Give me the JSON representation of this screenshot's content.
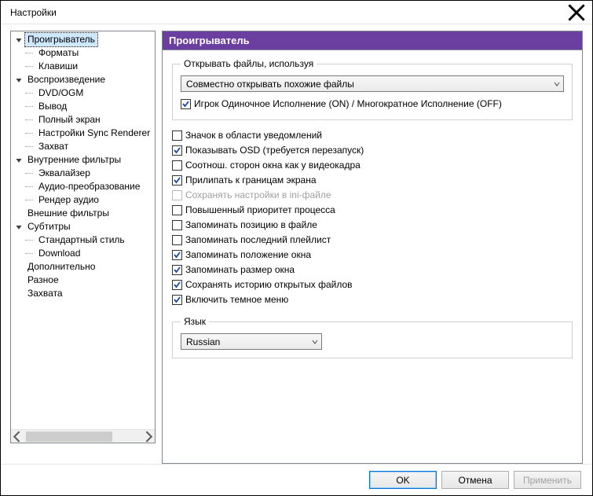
{
  "window": {
    "title": "Настройки"
  },
  "tree": {
    "items": [
      {
        "label": "Проигрыватель",
        "type": "root",
        "expanded": true,
        "selected": true
      },
      {
        "label": "Форматы",
        "type": "child"
      },
      {
        "label": "Клавиши",
        "type": "child"
      },
      {
        "label": "Воспроизведение",
        "type": "root",
        "expanded": true
      },
      {
        "label": "DVD/OGM",
        "type": "child"
      },
      {
        "label": "Вывод",
        "type": "child"
      },
      {
        "label": "Полный экран",
        "type": "child"
      },
      {
        "label": "Настройки Sync Renderer",
        "type": "child"
      },
      {
        "label": "Захват",
        "type": "child"
      },
      {
        "label": "Внутренние фильтры",
        "type": "root",
        "expanded": true
      },
      {
        "label": "Эквалайзер",
        "type": "child"
      },
      {
        "label": "Аудио-преобразование",
        "type": "child"
      },
      {
        "label": "Рендер аудио",
        "type": "child"
      },
      {
        "label": "Внешние фильтры",
        "type": "root",
        "noarrow": true
      },
      {
        "label": "Субтитры",
        "type": "root",
        "expanded": true
      },
      {
        "label": "Стандартный стиль",
        "type": "child"
      },
      {
        "label": "Download",
        "type": "child"
      },
      {
        "label": "Дополнительно",
        "type": "root",
        "noarrow": true
      },
      {
        "label": "Разное",
        "type": "root",
        "noarrow": true
      },
      {
        "label": "Захвата",
        "type": "root",
        "noarrow": true
      }
    ]
  },
  "page": {
    "heading": "Проигрыватель",
    "open_group": {
      "legend": "Открывать файлы, используя",
      "combo": "Совместно открывать похожие файлы",
      "single_instance": {
        "label": "Игрок Одиночное Исполнение (ON) / Многократное Исполнение (OFF)",
        "checked": true
      }
    },
    "options": [
      {
        "label": "Значок в области уведомлений",
        "checked": false
      },
      {
        "label": "Показывать OSD (требуется перезапуск)",
        "checked": true
      },
      {
        "label": "Соотнош. сторон окна как у видеокадра",
        "checked": false
      },
      {
        "label": "Прилипать к границам экрана",
        "checked": true
      },
      {
        "label": "Сохранять настройки в ini-файле",
        "checked": false,
        "disabled": true
      },
      {
        "label": "Повышенный приоритет процесса",
        "checked": false
      },
      {
        "label": "Запоминать позицию в файле",
        "checked": false
      },
      {
        "label": "Запоминать последний плейлист",
        "checked": false
      },
      {
        "label": "Запоминать положение окна",
        "checked": true
      },
      {
        "label": "Запоминать размер окна",
        "checked": true
      },
      {
        "label": "Сохранять историю открытых файлов",
        "checked": true
      },
      {
        "label": "Включить темное меню",
        "checked": true
      }
    ],
    "lang_group": {
      "legend": "Язык",
      "combo": "Russian"
    }
  },
  "buttons": {
    "ok": "OK",
    "cancel": "Отмена",
    "apply": "Применить"
  }
}
